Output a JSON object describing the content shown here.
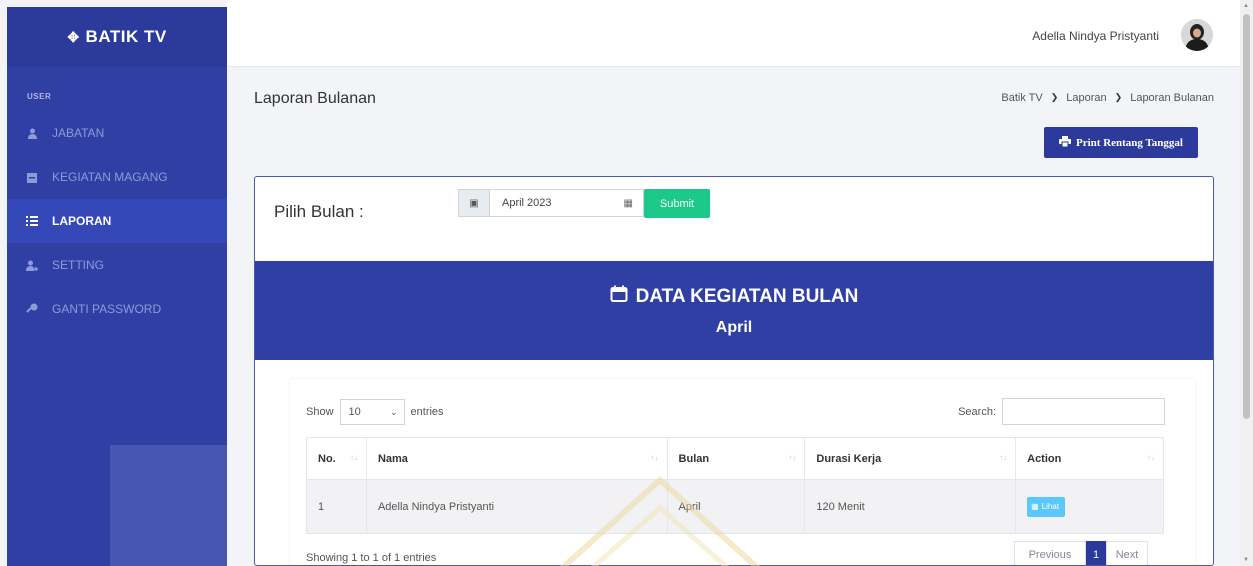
{
  "brand": {
    "name": "BATIK TV",
    "logo_icon": "arrows-cross-icon"
  },
  "sidebar": {
    "section_label": "USER",
    "items": [
      {
        "label": "JABATAN",
        "icon": "user-tie-icon",
        "active": false
      },
      {
        "label": "KEGIATAN MAGANG",
        "icon": "calendar-icon",
        "active": false
      },
      {
        "label": "LAPORAN",
        "icon": "list-icon",
        "active": true
      },
      {
        "label": "SETTING",
        "icon": "user-cog-icon",
        "active": false
      },
      {
        "label": "GANTI PASSWORD",
        "icon": "key-icon",
        "active": false
      }
    ]
  },
  "topbar": {
    "user_name": "Adella Nindya Pristyanti"
  },
  "page": {
    "title": "Laporan Bulanan",
    "breadcrumb": [
      "Batik TV",
      "Laporan",
      "Laporan Bulanan"
    ],
    "print_button": "Print Rentang Tanggal"
  },
  "filter": {
    "label": "Pilih Bulan :",
    "month_value": "April 2023",
    "submit_label": "Submit"
  },
  "banner": {
    "title": "DATA KEGIATAN BULAN",
    "subtitle": "April"
  },
  "table": {
    "show_label": "Show",
    "entries_value": "10",
    "entries_label": "entries",
    "search_label": "Search:",
    "search_value": "",
    "columns": [
      "No.",
      "Nama",
      "Bulan",
      "Durasi Kerja",
      "Action"
    ],
    "rows": [
      {
        "no": "1",
        "nama": "Adella Nindya Pristyanti",
        "bulan": "April",
        "durasi": "120 Menit",
        "action": "Lihat"
      }
    ],
    "showing_text": "Showing 1 to 1 of 1 entries",
    "pagination": {
      "previous": "Previous",
      "current": "1",
      "next": "Next"
    }
  },
  "colors": {
    "primary": "#2f3fa3",
    "success": "#1cc88a",
    "info": "#5ac8fa"
  }
}
